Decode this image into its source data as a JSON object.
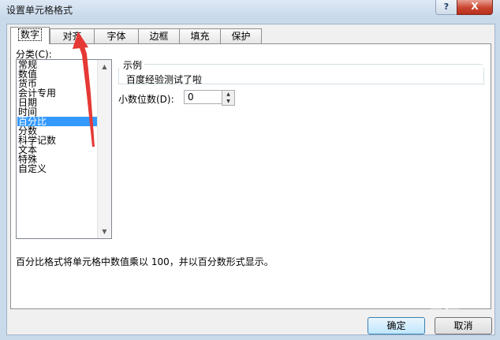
{
  "window": {
    "title": "设置单元格格式",
    "help_label": "?",
    "close_label": "X"
  },
  "tabs": [
    {
      "label": "数字",
      "active": true
    },
    {
      "label": "对齐",
      "active": false
    },
    {
      "label": "字体",
      "active": false
    },
    {
      "label": "边框",
      "active": false
    },
    {
      "label": "填充",
      "active": false
    },
    {
      "label": "保护",
      "active": false
    }
  ],
  "category": {
    "label": "分类(C):",
    "items": [
      "常规",
      "数值",
      "货币",
      "会计专用",
      "日期",
      "时间",
      "百分比",
      "分数",
      "科学记数",
      "文本",
      "特殊",
      "自定义"
    ],
    "selected": "百分比"
  },
  "sample": {
    "label": "示例",
    "value": "百度经验测试了啦"
  },
  "decimal": {
    "label": "小数位数(D):",
    "value": "0"
  },
  "description": "百分比格式将单元格中数值乘以 100，并以百分数形式显示。",
  "buttons": {
    "ok": "确定",
    "cancel": "取消"
  },
  "watermark": "Baidu 经验",
  "colors": {
    "selection": "#3399ff",
    "annotation_arrow": "#e53935"
  }
}
